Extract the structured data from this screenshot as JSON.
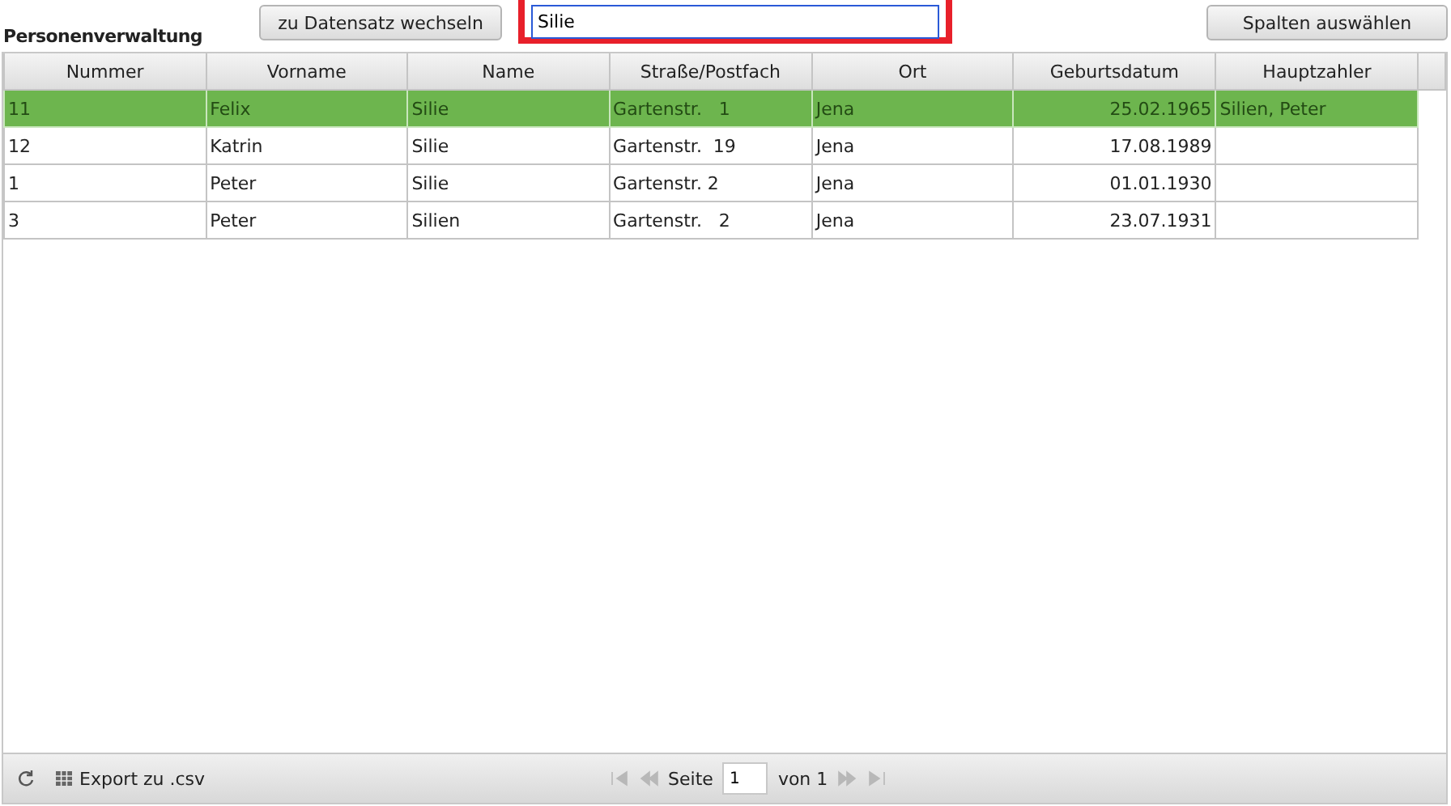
{
  "title": "Personenverwaltung",
  "goto_button": "zu Datensatz wechseln",
  "search": {
    "value": "Silie"
  },
  "columns_button": "Spalten auswählen",
  "table": {
    "columns": [
      "Nummer",
      "Vorname",
      "Name",
      "Straße/Postfach",
      "Ort",
      "Geburtsdatum",
      "Hauptzahler"
    ],
    "rows": [
      {
        "selected": true,
        "cells": [
          "11",
          "Felix",
          "Silie",
          "Gartenstr.   1",
          "Jena",
          "25.02.1965",
          "Silien, Peter"
        ]
      },
      {
        "selected": false,
        "cells": [
          "12",
          "Katrin",
          "Silie",
          "Gartenstr.  19",
          "Jena",
          "17.08.1989",
          ""
        ]
      },
      {
        "selected": false,
        "cells": [
          "1",
          "Peter",
          "Silie",
          "Gartenstr. 2",
          "Jena",
          "01.01.1930",
          ""
        ]
      },
      {
        "selected": false,
        "cells": [
          "3",
          "Peter",
          "Silien",
          "Gartenstr.   2",
          "Jena",
          "23.07.1931",
          ""
        ]
      }
    ]
  },
  "footer": {
    "export": "Export zu .csv",
    "page_label": "Seite",
    "page": "1",
    "page_total": "von 1"
  }
}
